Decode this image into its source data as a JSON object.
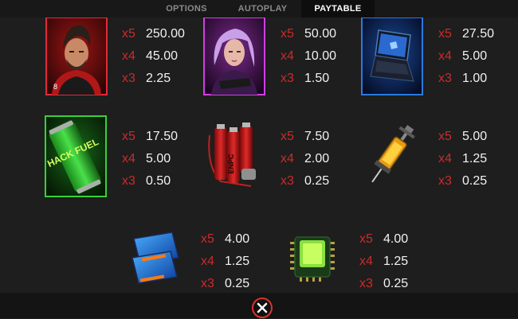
{
  "tabs": [
    {
      "label": "OPTIONS"
    },
    {
      "label": "AUTOPLAY"
    },
    {
      "label": "PAYTABLE",
      "active": true
    }
  ],
  "colors": {
    "multiplier": "#cc2a2a",
    "value": "#f2f2f2",
    "background": "#1e1e1e",
    "tab_active_text": "#ffffff",
    "tab_inactive_text": "#8a8a8a"
  },
  "paytable": [
    {
      "symbol": "male-hacker",
      "icon": "male-hacker-icon",
      "payouts": [
        {
          "mult": "x5",
          "value": "250.00"
        },
        {
          "mult": "x4",
          "value": "45.00"
        },
        {
          "mult": "x3",
          "value": "2.25"
        }
      ]
    },
    {
      "symbol": "female-hacker",
      "icon": "female-hacker-icon",
      "payouts": [
        {
          "mult": "x5",
          "value": "50.00"
        },
        {
          "mult": "x4",
          "value": "10.00"
        },
        {
          "mult": "x3",
          "value": "1.50"
        }
      ]
    },
    {
      "symbol": "laptop",
      "icon": "laptop-icon",
      "payouts": [
        {
          "mult": "x5",
          "value": "27.50"
        },
        {
          "mult": "x4",
          "value": "5.00"
        },
        {
          "mult": "x3",
          "value": "1.00"
        }
      ]
    },
    {
      "symbol": "energy-can",
      "icon": "energy-can-icon",
      "label": "HACK FUEL",
      "payouts": [
        {
          "mult": "x5",
          "value": "17.50"
        },
        {
          "mult": "x4",
          "value": "5.00"
        },
        {
          "mult": "x3",
          "value": "0.50"
        }
      ]
    },
    {
      "symbol": "battery-pack",
      "icon": "battery-pack-icon",
      "label": "ENPC",
      "payouts": [
        {
          "mult": "x5",
          "value": "7.50"
        },
        {
          "mult": "x4",
          "value": "2.00"
        },
        {
          "mult": "x3",
          "value": "0.25"
        }
      ]
    },
    {
      "symbol": "syringe",
      "icon": "syringe-icon",
      "payouts": [
        {
          "mult": "x5",
          "value": "5.00"
        },
        {
          "mult": "x4",
          "value": "1.25"
        },
        {
          "mult": "x3",
          "value": "0.25"
        }
      ]
    },
    {
      "symbol": "memory-drive",
      "icon": "memory-drive-icon",
      "payouts": [
        {
          "mult": "x5",
          "value": "4.00"
        },
        {
          "mult": "x4",
          "value": "1.25"
        },
        {
          "mult": "x3",
          "value": "0.25"
        }
      ]
    },
    {
      "symbol": "microchip",
      "icon": "microchip-icon",
      "payouts": [
        {
          "mult": "x5",
          "value": "4.00"
        },
        {
          "mult": "x4",
          "value": "1.25"
        },
        {
          "mult": "x3",
          "value": "0.25"
        }
      ]
    }
  ],
  "close_button": {
    "icon": "close-icon"
  }
}
